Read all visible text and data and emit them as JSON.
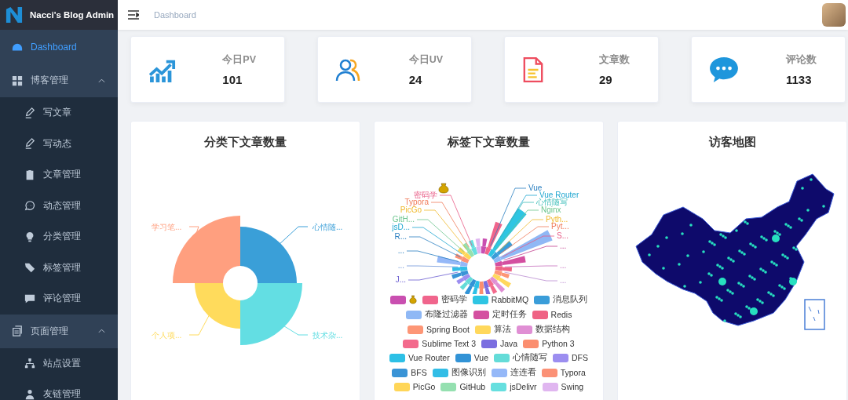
{
  "sidebar": {
    "title": "Nacci's Blog Admin",
    "items": [
      {
        "label": "Dashboard",
        "selected": true
      },
      {
        "label": "博客管理",
        "selected": false,
        "expanded": true,
        "children": [
          {
            "label": "写文章",
            "selected": false
          },
          {
            "label": "写动态",
            "selected": false
          },
          {
            "label": "文章管理",
            "selected": false
          },
          {
            "label": "动态管理",
            "selected": false
          },
          {
            "label": "分类管理",
            "selected": false
          },
          {
            "label": "标签管理",
            "selected": false
          },
          {
            "label": "评论管理",
            "selected": false
          }
        ]
      },
      {
        "label": "页面管理",
        "selected": false,
        "expanded": true,
        "children": [
          {
            "label": "站点设置",
            "selected": false
          },
          {
            "label": "友链管理",
            "selected": false
          }
        ]
      }
    ]
  },
  "header": {
    "breadcrumb": "Dashboard"
  },
  "stats": [
    {
      "label": "今日PV",
      "value": "101"
    },
    {
      "label": "今日UV",
      "value": "24"
    },
    {
      "label": "文章数",
      "value": "29"
    },
    {
      "label": "评论数",
      "value": "1133"
    }
  ],
  "panels": [
    {
      "kind": "category_rose",
      "title": "分类下文章数量",
      "labels": [
        {
          "text": "学习笔...",
          "color": "#ff9f7f"
        },
        {
          "text": "心情随...",
          "color": "#3a9fd8"
        },
        {
          "text": "个人项...",
          "color": "#ffdb5c"
        },
        {
          "text": "技术杂...",
          "color": "#63dee3"
        }
      ]
    },
    {
      "kind": "tag_rose",
      "title": "标签下文章数量",
      "labels_left": [
        "密码学",
        "Typora",
        "PicGo",
        "GitH...",
        "jsD...",
        "R...",
        "...",
        "...",
        "J..."
      ],
      "labels_right": [
        "Vue",
        "Vue Router",
        "心情随写",
        "Nginx",
        "Pyth...",
        "Pyt...",
        "S...",
        "...",
        "...",
        "..."
      ],
      "legend": [
        {
          "kind": "icon",
          "color": "#c94fb0"
        },
        {
          "kind": "text",
          "text": "密码学",
          "color": "#f0658c"
        },
        {
          "kind": "text",
          "text": "RabbitMQ",
          "color": "#2ec5e3"
        },
        {
          "kind": "text",
          "text": "消息队列",
          "color": "#3a9dd9"
        },
        {
          "kind": "text",
          "text": "布隆过滤器",
          "color": "#8fb8f5"
        },
        {
          "kind": "text",
          "text": "定时任务",
          "color": "#d44fa0"
        },
        {
          "kind": "text",
          "text": "Redis",
          "color": "#ef6384"
        },
        {
          "kind": "text",
          "text": "Spring Boot",
          "color": "#fd9676"
        },
        {
          "kind": "text",
          "text": "算法",
          "color": "#ffd85c"
        },
        {
          "kind": "text",
          "text": "数据结构",
          "color": "#e08fd4"
        },
        {
          "kind": "text",
          "text": "Sublime Text 3",
          "color": "#f36a8c"
        },
        {
          "kind": "text",
          "text": "Java",
          "color": "#7b6ee0"
        },
        {
          "kind": "text",
          "text": "Python 3",
          "color": "#fb8e6f"
        },
        {
          "kind": "text",
          "text": "Vue Router",
          "color": "#2dc0e6"
        },
        {
          "kind": "text",
          "text": "Vue",
          "color": "#3293d6"
        },
        {
          "kind": "text",
          "text": "心情随写",
          "color": "#64dcd8"
        },
        {
          "kind": "text",
          "text": "DFS",
          "color": "#9c8ef0"
        },
        {
          "kind": "text",
          "text": "BFS",
          "color": "#3a94d6"
        },
        {
          "kind": "text",
          "text": "图像识别",
          "color": "#32bde6"
        },
        {
          "kind": "text",
          "text": "连连看",
          "color": "#95b8f8"
        },
        {
          "kind": "text",
          "text": "Typora",
          "color": "#fb9176"
        },
        {
          "kind": "text",
          "text": "PicGo",
          "color": "#ffd658"
        },
        {
          "kind": "text",
          "text": "GitHub",
          "color": "#95e0b0"
        },
        {
          "kind": "text",
          "text": "jsDelivr",
          "color": "#66dfdf"
        },
        {
          "kind": "text",
          "text": "Swing",
          "color": "#e0b6f0"
        }
      ]
    },
    {
      "kind": "map",
      "title": "访客地图"
    }
  ]
}
